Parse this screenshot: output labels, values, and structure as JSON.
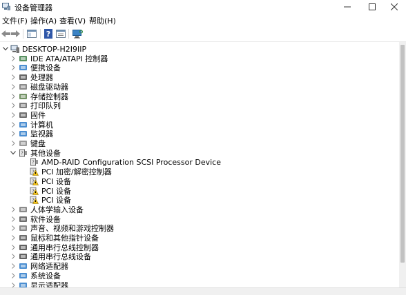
{
  "window": {
    "title": "设备管理器"
  },
  "menu": [
    "文件(F)",
    "操作(A)",
    "查看(V)",
    "帮助(H)"
  ],
  "tree": {
    "root": "DESKTOP-H2I9IIP",
    "categories": [
      {
        "label": "IDE ATA/ATAPI 控制器",
        "icon": "ide-controller-icon",
        "color": "#3a7d44"
      },
      {
        "label": "便携设备",
        "icon": "portable-device-icon",
        "color": "#2b7ac9"
      },
      {
        "label": "处理器",
        "icon": "processor-icon",
        "color": "#4a4a4a"
      },
      {
        "label": "磁盘驱动器",
        "icon": "disk-drive-icon",
        "color": "#777777"
      },
      {
        "label": "存储控制器",
        "icon": "storage-controller-icon",
        "color": "#5a7f4a"
      },
      {
        "label": "打印队列",
        "icon": "print-queue-icon",
        "color": "#666666"
      },
      {
        "label": "固件",
        "icon": "firmware-icon",
        "color": "#555555"
      },
      {
        "label": "计算机",
        "icon": "computer-icon",
        "color": "#2b7ac9"
      },
      {
        "label": "监视器",
        "icon": "monitor-icon",
        "color": "#2b7ac9"
      },
      {
        "label": "键盘",
        "icon": "keyboard-icon",
        "color": "#888888"
      },
      {
        "label": "其他设备",
        "icon": "other-devices-icon",
        "color": "#666666",
        "expanded": true,
        "children": [
          {
            "label": "AMD-RAID Configuration SCSI Processor Device",
            "icon": "unknown-device-icon"
          },
          {
            "label": "PCI 加密/解密控制器",
            "icon": "unknown-device-warning-icon"
          },
          {
            "label": "PCI 设备",
            "icon": "unknown-device-warning-icon"
          },
          {
            "label": "PCI 设备",
            "icon": "unknown-device-warning-icon"
          },
          {
            "label": "PCI 设备",
            "icon": "unknown-device-warning-icon"
          }
        ]
      },
      {
        "label": "人体学输入设备",
        "icon": "hid-icon",
        "color": "#777777"
      },
      {
        "label": "软件设备",
        "icon": "software-device-icon",
        "color": "#555555"
      },
      {
        "label": "声音、视频和游戏控制器",
        "icon": "sound-icon",
        "color": "#777777"
      },
      {
        "label": "鼠标和其他指针设备",
        "icon": "mouse-icon",
        "color": "#555555"
      },
      {
        "label": "通用串行总线控制器",
        "icon": "usb-controller-icon",
        "color": "#444444"
      },
      {
        "label": "通用串行总线设备",
        "icon": "usb-device-icon",
        "color": "#444444"
      },
      {
        "label": "网络适配器",
        "icon": "network-adapter-icon",
        "color": "#2b7ac9"
      },
      {
        "label": "系统设备",
        "icon": "system-device-icon",
        "color": "#2b7ac9"
      },
      {
        "label": "显示适配器",
        "icon": "display-adapter-icon",
        "color": "#2b7ac9"
      }
    ]
  }
}
